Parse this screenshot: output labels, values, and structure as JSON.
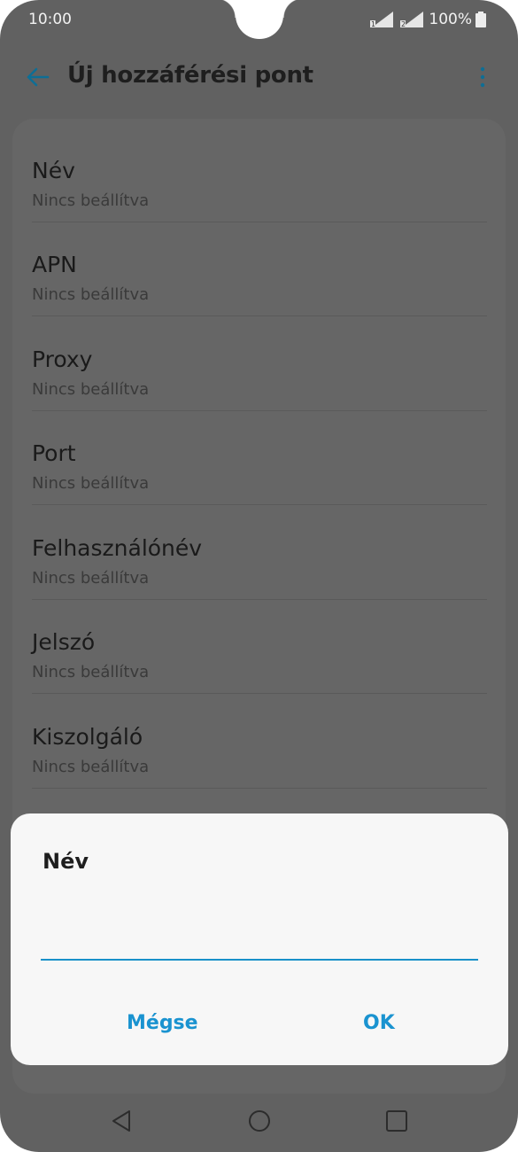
{
  "status_bar": {
    "time": "10:00",
    "battery": "100%"
  },
  "app_bar": {
    "title": "Új hozzáférési pont"
  },
  "list_items": [
    {
      "label": "Név",
      "value": "Nincs beállítva"
    },
    {
      "label": "APN",
      "value": "Nincs beállítva"
    },
    {
      "label": "Proxy",
      "value": "Nincs beállítva"
    },
    {
      "label": "Port",
      "value": "Nincs beállítva"
    },
    {
      "label": "Felhasználónév",
      "value": "Nincs beállítva"
    },
    {
      "label": "Jelszó",
      "value": "Nincs beállítva"
    },
    {
      "label": "Kiszolgáló",
      "value": "Nincs beállítva"
    }
  ],
  "dialog": {
    "title": "Név",
    "input_value": "",
    "cancel_label": "Mégse",
    "ok_label": "OK"
  },
  "colors": {
    "accent": "#1a93d0",
    "dim_overlay": "#616161"
  }
}
